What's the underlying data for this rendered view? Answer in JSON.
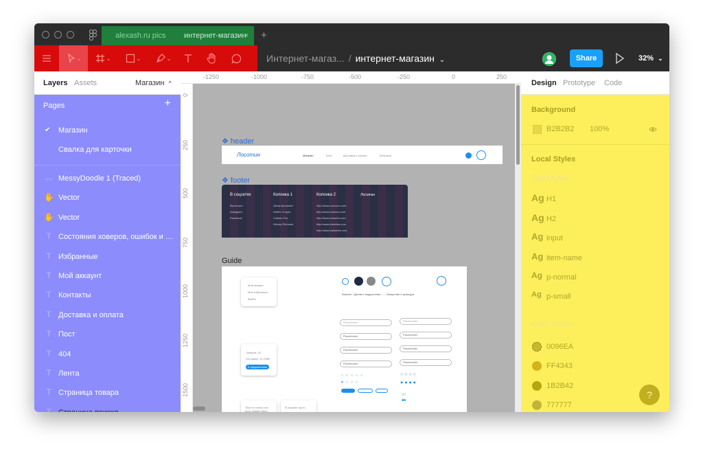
{
  "tabs": {
    "files": "alexash.ru pics",
    "active": "интернет-магазин",
    "close": "×",
    "add": "+"
  },
  "toolbar": {
    "file_name": "Интернет-магаз...",
    "separator": "/",
    "page_name": "интернет-магазин",
    "page_chevron": "⌄",
    "share_label": "Share",
    "zoom": "32%",
    "zoom_chevron": "⌄",
    "tools": [
      "main-menu-icon",
      "move-tool-icon",
      "frame-tool-icon",
      "rectangle-tool-icon",
      "pen-tool-icon",
      "text-tool-icon",
      "hand-tool-icon",
      "comment-tool-icon"
    ],
    "accent": "#d80b0b"
  },
  "left_panel": {
    "tab_layers": "Layers",
    "tab_assets": "Assets",
    "page_selector": "Магазин",
    "page_selector_chevron": "^",
    "pages_title": "Pages",
    "pages_add": "+",
    "pages": [
      {
        "name": "Магазин",
        "checked": true
      },
      {
        "name": "Свалка для карточки",
        "checked": false
      }
    ],
    "layers": [
      {
        "icon": "traced-icon",
        "name": "MessyDoodle 1 (Traced)"
      },
      {
        "icon": "vector-icon",
        "name": "Vector"
      },
      {
        "icon": "vector-icon",
        "name": "Vector"
      },
      {
        "icon": "text-icon",
        "name": "Состояния ховеров, ошибок и не..."
      },
      {
        "icon": "text-icon",
        "name": "Избранные"
      },
      {
        "icon": "text-icon",
        "name": "Мой аккаунт"
      },
      {
        "icon": "text-icon",
        "name": "Контакты"
      },
      {
        "icon": "text-icon",
        "name": "Доставка и оплата"
      },
      {
        "icon": "text-icon",
        "name": "Пост"
      },
      {
        "icon": "text-icon",
        "name": "404"
      },
      {
        "icon": "text-icon",
        "name": "Лента"
      },
      {
        "icon": "text-icon",
        "name": "Страница товара"
      },
      {
        "icon": "text-icon",
        "name": "Страница поиска"
      }
    ],
    "highlight": "#8c8cfd"
  },
  "canvas": {
    "ruler_top": [
      "-1250",
      "-1000",
      "-750",
      "-500",
      "-250",
      "0",
      "250"
    ],
    "ruler_left": [
      "0",
      "250",
      "500",
      "750",
      "1000",
      "1250",
      "1500"
    ],
    "background": "#b2b2b2",
    "frames": {
      "header": {
        "label": "header",
        "logo": "Лосотин",
        "nav": [
          "Магазин",
          "Блог",
          "Доставка и оплата",
          "Контакты"
        ]
      },
      "footer": {
        "label": "footer",
        "col1_title": "В соцсетях",
        "col1_items": [
          "Вконтакте",
          "Instagram",
          "Facebook"
        ],
        "col2_title": "Колонка 1",
        "col2_items": [
          "Olivia Alexander",
          "Noitrix Cropse",
          "Colleen Fox",
          "Wendy Richards"
        ],
        "col3_title": "Колонка 2",
        "col3_items": [
          "http://www.corxcom.com",
          "http://www.culmcre.com",
          "http://www.cstrubre.com",
          "http://www.luktelina.com",
          "http://www.saltumbe.com"
        ],
        "logo": "Лосотин"
      },
      "guide": {
        "label": "Guide",
        "menu_items": [
          "Мой аккаунт",
          "Мои избранные",
          "Выйти"
        ],
        "breadcrumb": "Каталог / Детям и подросткам / ... / Искусство и культура",
        "promo_lines": [
          "Товаров: 15",
          "На сумму: 13 200₽"
        ],
        "promo_button": "К оформлению",
        "placeholder": "Placeholder",
        "bubble_1": "Текст в очень хоть есть. Может быть",
        "bubble_2": "В корзине пусто"
      }
    }
  },
  "right_panel": {
    "tab_design": "Design",
    "tab_prototype": "Prototype",
    "tab_code": "Code",
    "background_title": "Background",
    "background_color": "B2B2B2",
    "background_opacity": "100%",
    "local_styles_title": "Local Styles",
    "text_styles_title": "Text Styles",
    "ag_glyph": "Ag",
    "text_styles": [
      "H1",
      "H2",
      "input",
      "item-name",
      "p-normal",
      "p-small"
    ],
    "color_styles_title": "Color Styles",
    "color_styles": [
      "0096EA",
      "FF4343",
      "1B2B42",
      "777777"
    ],
    "help": "?",
    "highlight": "#fdef5b"
  }
}
